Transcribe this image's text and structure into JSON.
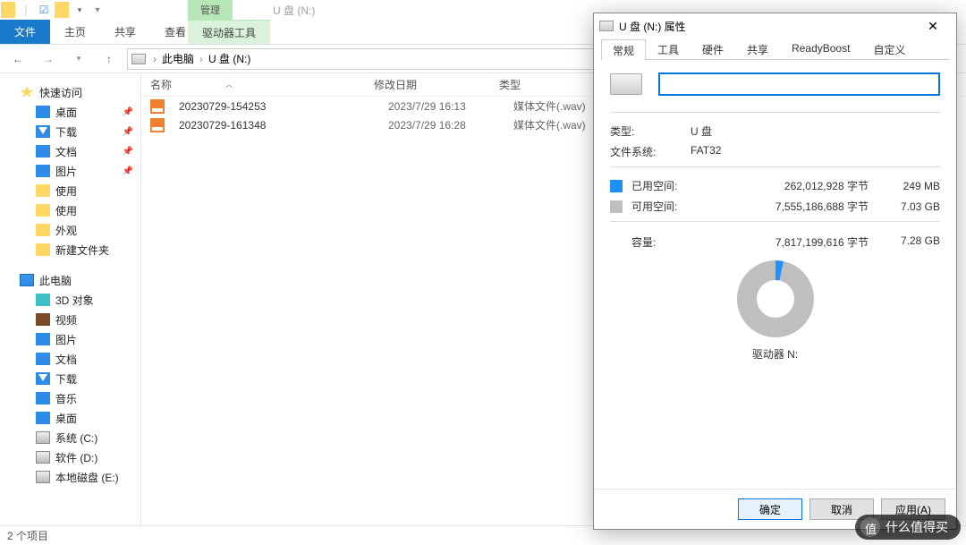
{
  "titlebar": {
    "manage_label": "管理",
    "window_title": "U 盘 (N:)"
  },
  "ribbon": {
    "file": "文件",
    "home": "主页",
    "share": "共享",
    "view": "查看",
    "drive_tools": "驱动器工具"
  },
  "address": {
    "crumb1": "此电脑",
    "crumb2": "U 盘 (N:)"
  },
  "sidebar": {
    "quick_access": "快速访问",
    "desktop": "桌面",
    "downloads": "下载",
    "documents": "文档",
    "pictures": "图片",
    "use1": "使用",
    "use2": "使用",
    "appearance": "外观",
    "new_folder": "新建文件夹",
    "this_pc": "此电脑",
    "objects_3d": "3D 对象",
    "videos": "视频",
    "pictures2": "图片",
    "documents2": "文档",
    "downloads2": "下载",
    "music": "音乐",
    "desktop2": "桌面",
    "drive_c": "系统 (C:)",
    "drive_d": "软件 (D:)",
    "drive_e": "本地磁盘 (E:)"
  },
  "columns": {
    "name": "名称",
    "date": "修改日期",
    "type": "类型"
  },
  "files": [
    {
      "name": "20230729-154253",
      "date": "2023/7/29 16:13",
      "type": "媒体文件(.wav)"
    },
    {
      "name": "20230729-161348",
      "date": "2023/7/29 16:28",
      "type": "媒体文件(.wav)"
    }
  ],
  "statusbar": {
    "count": "2 个项目"
  },
  "dialog": {
    "title": "U 盘 (N:) 属性",
    "tabs": {
      "general": "常规",
      "tools": "工具",
      "hardware": "硬件",
      "sharing": "共享",
      "readyboost": "ReadyBoost",
      "custom": "自定义"
    },
    "name_value": "",
    "type_label": "类型:",
    "type_value": "U 盘",
    "fs_label": "文件系统:",
    "fs_value": "FAT32",
    "used_label": "已用空间:",
    "used_bytes": "262,012,928 字节",
    "used_hr": "249 MB",
    "free_label": "可用空间:",
    "free_bytes": "7,555,186,688 字节",
    "free_hr": "7.03 GB",
    "capacity_label": "容量:",
    "capacity_bytes": "7,817,199,616 字节",
    "capacity_hr": "7.28 GB",
    "drive_label": "驱动器 N:",
    "ok": "确定",
    "cancel": "取消",
    "apply": "应用(A)"
  },
  "watermark": "什么值得买"
}
